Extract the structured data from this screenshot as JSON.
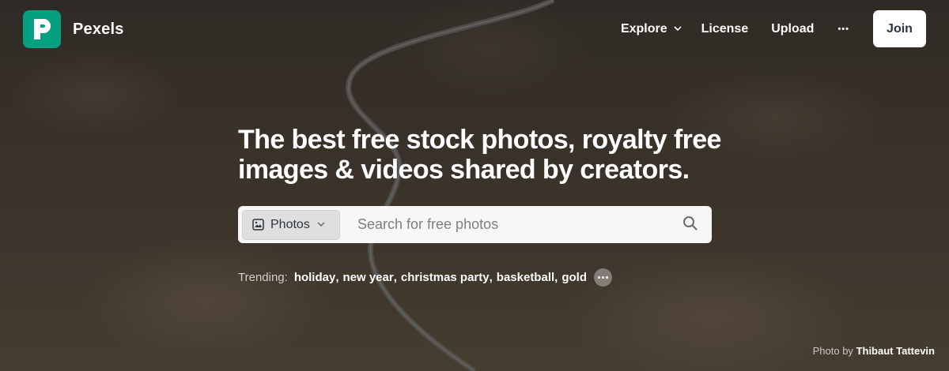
{
  "brand": {
    "name": "Pexels",
    "color": "#05a081"
  },
  "nav": {
    "explore": "Explore",
    "license": "License",
    "upload": "Upload",
    "more": "•••",
    "join": "Join"
  },
  "hero": {
    "headline_line1": "The best free stock photos, royalty free",
    "headline_line2": "images & videos shared by creators."
  },
  "search": {
    "type_selected": "Photos",
    "placeholder": "Search for free photos",
    "value": ""
  },
  "trending": {
    "label": "Trending:",
    "items": [
      "holiday",
      "new year",
      "christmas party",
      "basketball",
      "gold"
    ]
  },
  "credit": {
    "prefix": "Photo by",
    "author": "Thibaut Tattevin"
  }
}
